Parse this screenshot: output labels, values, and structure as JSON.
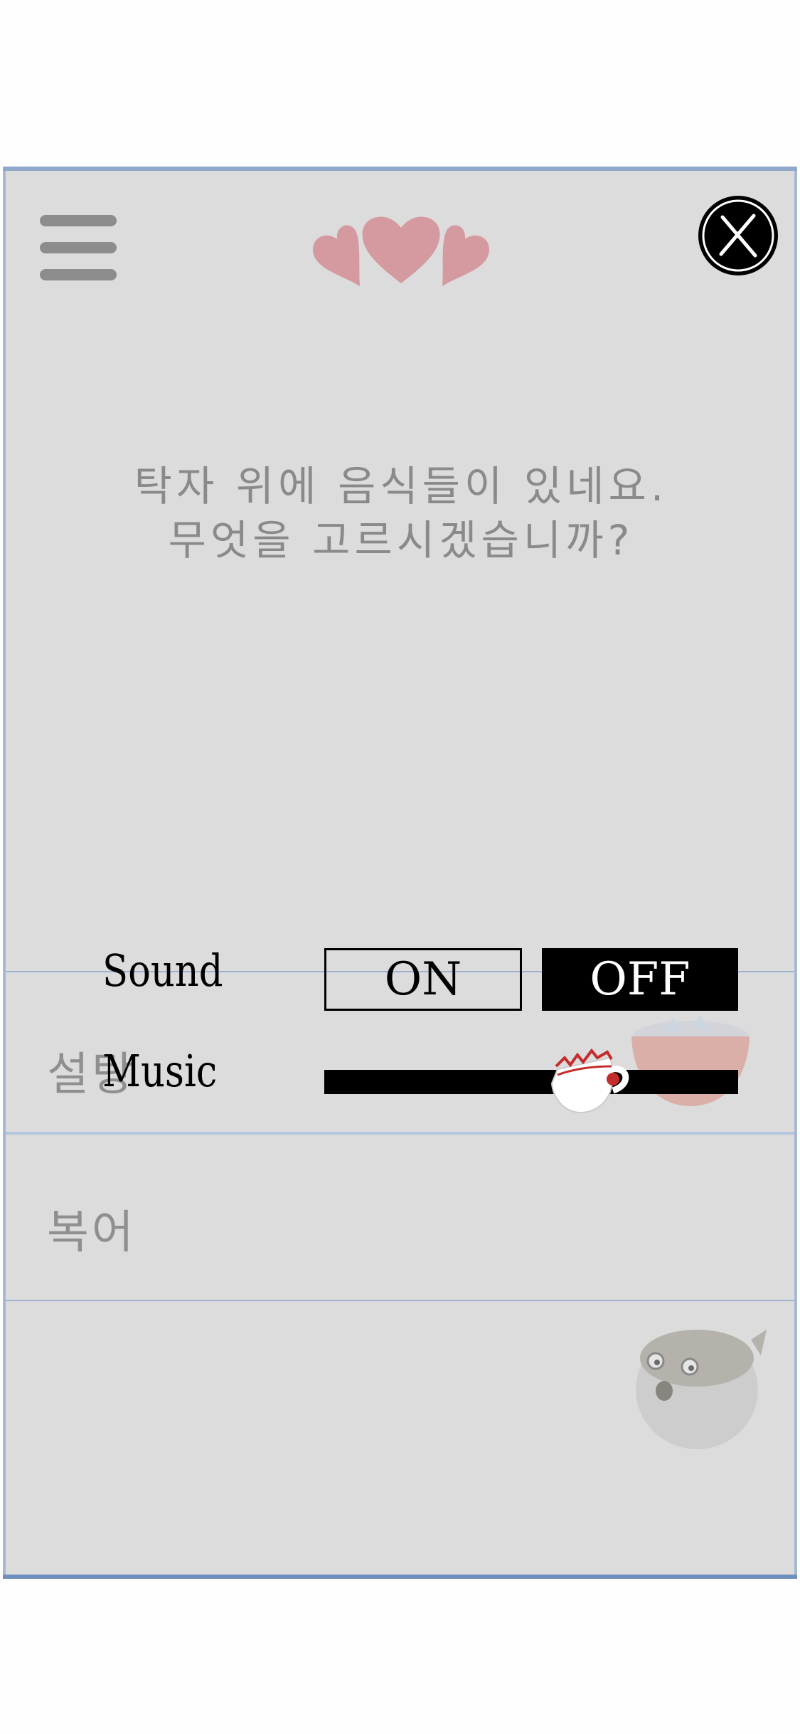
{
  "question": {
    "line1": "탁자 위에 음식들이 있네요.",
    "line2": "무엇을 고르시겠습니까?"
  },
  "items": [
    {
      "label": "설탕"
    },
    {
      "label": "복어"
    }
  ],
  "settings": {
    "sound_label": "Sound",
    "on_label": "ON",
    "off_label": "OFF",
    "sound_selected": "OFF",
    "music_label": "Music",
    "music_volume": 0.64
  },
  "icons": {
    "menu": "hamburger-menu-icon",
    "logo": "hearts-icon",
    "close": "close-icon",
    "knob": "teacup-icon"
  },
  "colors": {
    "panel": "#dcdcdc",
    "hearts": "#d49a9f",
    "active_toggle": "#000000"
  }
}
